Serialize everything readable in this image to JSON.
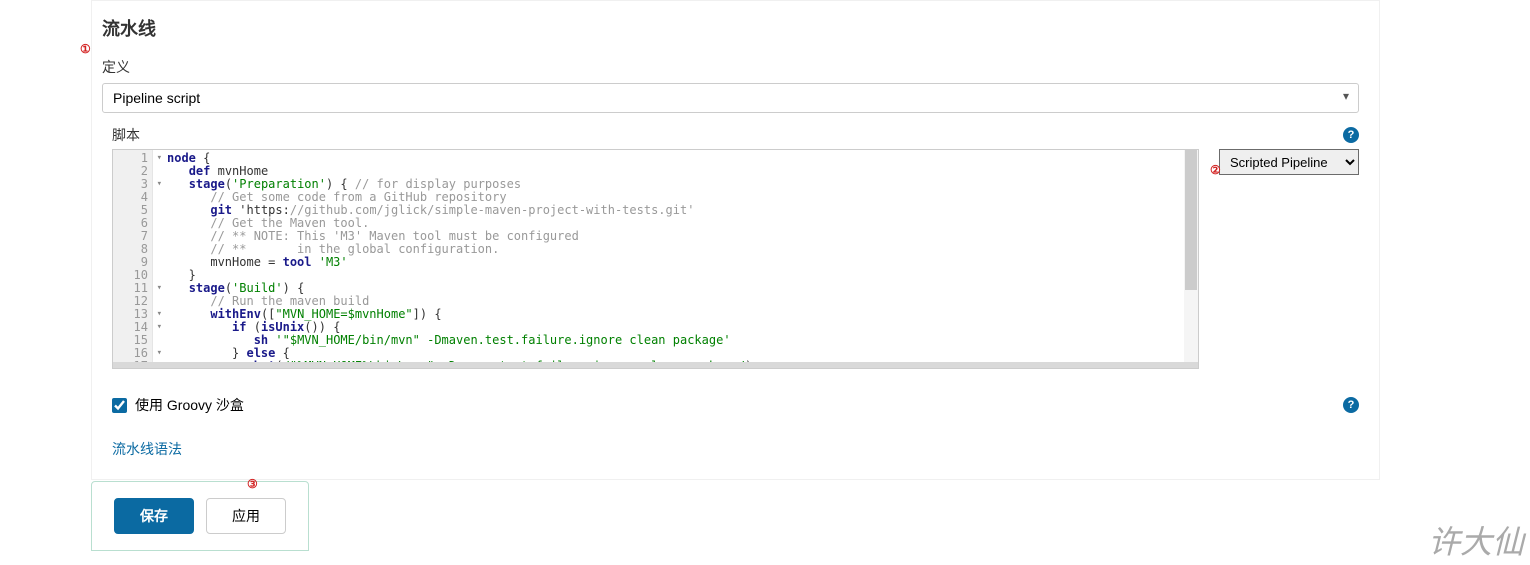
{
  "section_title": "流水线",
  "definition": {
    "label": "定义",
    "selected": "Pipeline script"
  },
  "script": {
    "label": "脚本",
    "template_selected": "Scripted Pipeline",
    "code_lines": [
      "node {",
      "   def mvnHome",
      "   stage('Preparation') { // for display purposes",
      "      // Get some code from a GitHub repository",
      "      git 'https://github.com/jglick/simple-maven-project-with-tests.git'",
      "      // Get the Maven tool.",
      "      // ** NOTE: This 'M3' Maven tool must be configured",
      "      // **       in the global configuration.",
      "      mvnHome = tool 'M3'",
      "   }",
      "   stage('Build') {",
      "      // Run the maven build",
      "      withEnv([\"MVN_HOME=$mvnHome\"]) {",
      "         if (isUnix()) {",
      "            sh '\"$MVN_HOME/bin/mvn\" -Dmaven.test.failure.ignore clean package'",
      "         } else {",
      "            bat(/\"%MVN_HOME%\\bin\\mvn\" -Dmaven.test.failure.ignore clean package/)"
    ],
    "fold_lines": [
      1,
      3,
      11,
      13,
      14,
      16
    ]
  },
  "sandbox": {
    "checked": true,
    "label": "使用 Groovy 沙盒"
  },
  "syntax_link": "流水线语法",
  "buttons": {
    "save": "保存",
    "apply": "应用"
  },
  "annotations": {
    "a1": "①",
    "a2": "②",
    "a3": "③"
  },
  "watermark": "许大仙"
}
